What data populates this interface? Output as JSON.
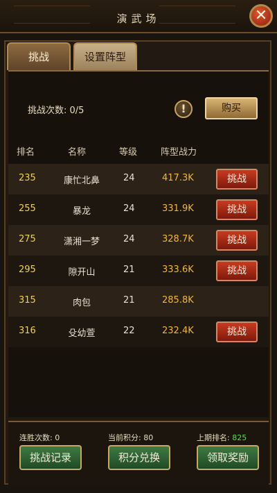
{
  "title": "演武场",
  "tabs": {
    "active": "挑战",
    "inactive": "设置阵型"
  },
  "challenge": {
    "label": "挑战次数: ",
    "count": "0/5",
    "buy_label": "购买"
  },
  "table": {
    "headers": [
      "排名",
      "名称",
      "等级",
      "阵型战力"
    ],
    "rows": [
      {
        "rank": "235",
        "name": "康忙北鼻",
        "level": "24",
        "power": "417.3K",
        "action": "挑战"
      },
      {
        "rank": "255",
        "name": "暴龙",
        "level": "24",
        "power": "331.9K",
        "action": "挑战"
      },
      {
        "rank": "275",
        "name": "潇湘一梦",
        "level": "24",
        "power": "328.7K",
        "action": "挑战"
      },
      {
        "rank": "295",
        "name": "隙开山",
        "level": "21",
        "power": "333.6K",
        "action": "挑战"
      },
      {
        "rank": "315",
        "name": "肉包",
        "level": "21",
        "power": "285.8K",
        "action": ""
      },
      {
        "rank": "316",
        "name": "殳幼萱",
        "level": "22",
        "power": "232.4K",
        "action": "挑战"
      }
    ]
  },
  "footer": {
    "win_streak_label": "连胜次数: ",
    "win_streak_value": "0",
    "score_label": "当前积分: ",
    "score_value": "80",
    "last_rank_label": "上期排名: ",
    "last_rank_value": "825",
    "buttons": {
      "record": "挑战记录",
      "exchange": "积分兑换",
      "reward": "领取奖励"
    }
  },
  "colors": {
    "rank": "#f0d640",
    "power": "#f0b838",
    "last_rank": "#5ee046",
    "fight_button": "#c83a20",
    "bottom_button": "#3f7a44"
  },
  "icons": {
    "close": "close-icon",
    "alert": "exclamation-icon"
  }
}
